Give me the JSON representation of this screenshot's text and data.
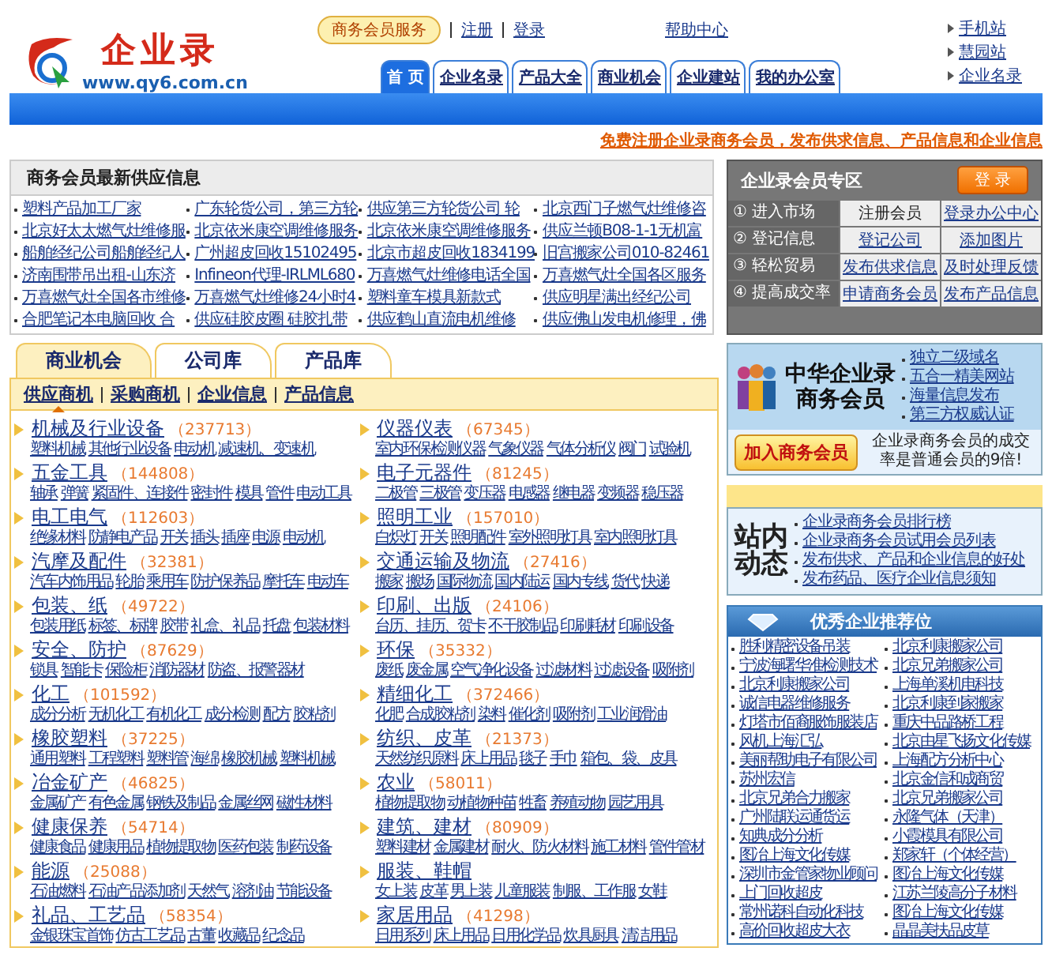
{
  "header": {
    "logo_text": "企业录",
    "logo_url": "www.qy6.com.cn",
    "service_badge": "商务会员服务",
    "links": [
      "注册",
      "登录"
    ],
    "help": "帮助中心",
    "nav": [
      {
        "label": "首 页",
        "selected": true
      },
      {
        "label": "企业名录",
        "selected": false
      },
      {
        "label": "产品大全",
        "selected": false
      },
      {
        "label": "商业机会",
        "selected": false
      },
      {
        "label": "企业建站",
        "selected": false
      },
      {
        "label": "我的办公室",
        "selected": false
      }
    ],
    "side_links": [
      "手机站",
      "慧园站",
      "企业名录"
    ]
  },
  "promo_link": "免费注册企业录商务会员，发布供求信息、产品信息和企业信息",
  "supply": {
    "title": "商务会员最新供应信息",
    "rows": [
      [
        "塑料产品加工厂家",
        "广东轮货公司，第三方轮",
        "供应第三方轮货公司 轮",
        "北京西门子燃气灶维修咨"
      ],
      [
        "北京好太太燃气灶维修服",
        "北京依米康空调维修服务",
        "北京依米康空调维修服务",
        "供应兰顿B08-1-1无机富"
      ],
      [
        "船舶经纪公司船舶经纪人",
        "广州超皮回收15102495",
        "北京市超皮回收1834199",
        "旧宫搬家公司010-82461"
      ],
      [
        "济南围带吊出租-山东济",
        "Infineon代理-IRLML680",
        "万喜燃气灶维修电话全国",
        "万喜燃气灶全国各区服务"
      ],
      [
        "万喜燃气灶全国各市维修",
        "万喜燃气灶维修24小时4",
        "塑料童车模具新款式",
        "供应明星满出经纪公司"
      ],
      [
        "合肥笔记本电脑回收 合",
        "供应硅胶皮圈 硅胶扎带",
        "供应鹤山直流电机维修",
        "供应佛山发电机修理，佛"
      ]
    ]
  },
  "member_zone": {
    "title": "企业录会员专区",
    "login_button": "登 录",
    "rows": [
      {
        "num": "①",
        "label": "进入市场",
        "links": [
          {
            "text": "注册会员",
            "link": false
          },
          {
            "text": "登录办公中心",
            "link": true
          }
        ]
      },
      {
        "num": "②",
        "label": "登记信息",
        "links": [
          {
            "text": "登记公司",
            "link": true
          },
          {
            "text": "添加图片",
            "link": true
          }
        ]
      },
      {
        "num": "③",
        "label": "轻松贸易",
        "links": [
          {
            "text": "发布供求信息",
            "link": true
          },
          {
            "text": "及时处理反馈",
            "link": true
          }
        ]
      },
      {
        "num": "④",
        "label": "提高成交率",
        "links": [
          {
            "text": "申请商务会员",
            "link": true
          },
          {
            "text": "发布产品信息",
            "link": true
          }
        ]
      }
    ]
  },
  "biz_tabs": [
    {
      "label": "商业机会",
      "selected": true
    },
    {
      "label": "公司库",
      "selected": false
    },
    {
      "label": "产品库",
      "selected": false
    }
  ],
  "sub_tabs": [
    {
      "label": "供应商机",
      "selected": true
    },
    {
      "label": "采购商机",
      "selected": false
    },
    {
      "label": "企业信息",
      "selected": false
    },
    {
      "label": "产品信息",
      "selected": false
    }
  ],
  "categories": [
    {
      "name": "机械及行业设备",
      "count": "（237713）",
      "subs": [
        "塑料机械",
        "其他行业设备",
        "电动机",
        "减速机、变速机"
      ]
    },
    {
      "name": "仪器仪表",
      "count": "（67345）",
      "subs": [
        "室内环保检测仪器",
        "气象仪器",
        "气体分析仪",
        "阀门",
        "试验机"
      ]
    },
    {
      "name": "五金工具",
      "count": "（144808）",
      "subs": [
        "轴承",
        "弹簧",
        "紧固件、连接件",
        "密封件",
        "模具",
        "管件",
        "电动工具"
      ]
    },
    {
      "name": "电子元器件",
      "count": "（81245）",
      "subs": [
        "二极管",
        "三极管",
        "变压器",
        "电感器",
        "继电器",
        "变频器",
        "稳压器"
      ]
    },
    {
      "name": "电工电气",
      "count": "（112603）",
      "subs": [
        "绝缘材料",
        "防静电产品",
        "开关",
        "插头",
        "插座",
        "电源",
        "电动机"
      ]
    },
    {
      "name": "照明工业",
      "count": "（157010）",
      "subs": [
        "白炽灯",
        "开关",
        "照明配件",
        "室外照明灯具",
        "室内照明灯具"
      ]
    },
    {
      "name": "汽摩及配件",
      "count": "（32381）",
      "subs": [
        "汽车内饰用品",
        "轮胎",
        "乘用车",
        "防护保养品",
        "摩托车",
        "电动车"
      ]
    },
    {
      "name": "交通运输及物流",
      "count": "（27416）",
      "subs": [
        "搬家",
        "搬场",
        "国际物流",
        "国内陆运",
        "国内专线",
        "货代",
        "快递"
      ]
    },
    {
      "name": "包装、纸",
      "count": "（49722）",
      "subs": [
        "包装用纸",
        "标签、标牌",
        "胶带",
        "礼盒、礼品",
        "托盘",
        "包装材料"
      ]
    },
    {
      "name": "印刷、出版",
      "count": "（24106）",
      "subs": [
        "台历、挂历、贺卡",
        "不干胶制品",
        "印刷耗材",
        "印刷设备"
      ]
    },
    {
      "name": "安全、防护",
      "count": "（87629）",
      "subs": [
        "锁具",
        "智能卡",
        "保险柜",
        "消防器材",
        "防盗、报警器材"
      ]
    },
    {
      "name": "环保",
      "count": "（35332）",
      "subs": [
        "废纸",
        "废金属",
        "空气净化设备",
        "过滤材料",
        "过滤设备",
        "吸附剂"
      ]
    },
    {
      "name": "化工",
      "count": "（101592）",
      "subs": [
        "成分分析",
        "无机化工",
        "有机化工",
        "成分检测",
        "配方",
        "胶粘剂"
      ]
    },
    {
      "name": "精细化工",
      "count": "（372466）",
      "subs": [
        "化肥",
        "合成胶粘剂",
        "染料",
        "催化剂",
        "吸附剂",
        "工业润滑油"
      ]
    },
    {
      "name": "橡胶塑料",
      "count": "（37225）",
      "subs": [
        "通用塑料",
        "工程塑料",
        "塑料管",
        "海绵",
        "橡胶机械",
        "塑料机械"
      ]
    },
    {
      "name": "纺织、皮革",
      "count": "（21373）",
      "subs": [
        "天然纺织原料",
        "床上用品",
        "毯子",
        "手巾",
        "箱包、袋、皮具"
      ]
    },
    {
      "name": "冶金矿产",
      "count": "（46825）",
      "subs": [
        "金属矿产",
        "有色金属",
        "钢铁及制品",
        "金属丝网",
        "磁性材料"
      ]
    },
    {
      "name": "农业",
      "count": "（58011）",
      "subs": [
        "植物提取物",
        "动植物种苗",
        "牲畜",
        "养殖动物",
        "园艺用具"
      ]
    },
    {
      "name": "健康保养",
      "count": "（54714）",
      "subs": [
        "健康食品",
        "健康用品",
        "植物提取物",
        "医药包装",
        "制药设备"
      ]
    },
    {
      "name": "建筑、建材",
      "count": "（80909）",
      "subs": [
        "塑料建材",
        "金属建材",
        "耐火、防火材料",
        "施工材料",
        "管件管材"
      ]
    },
    {
      "name": "能源",
      "count": "（25088）",
      "subs": [
        "石油燃料",
        "石油产品添加剂",
        "天然气",
        "溶剂油",
        "节能设备"
      ]
    },
    {
      "name": "服装、鞋帽",
      "subs": [
        "女上装",
        "皮革",
        "男上装",
        "儿童服装",
        "制服、工作服",
        "女鞋"
      ]
    },
    {
      "name": "礼品、工艺品",
      "count": "（58354）",
      "subs": [
        "金银珠宝首饰",
        "仿古工艺品",
        "古董",
        "收藏品",
        "纪念品"
      ]
    },
    {
      "name": "家居用品",
      "count": "（41298）",
      "subs": [
        "日用系列",
        "床上用品",
        "日用化学品",
        "炊具厨具",
        "清洁用品"
      ]
    }
  ],
  "vip_banner": {
    "title_lines": [
      "中华企业录",
      "商务会员"
    ],
    "features": [
      "独立二级域名",
      "五合一精美网站",
      "海量信息发布",
      "第三方权威认证"
    ],
    "join_button": "加入商务会员",
    "note": "企业录商务会员的成交率是普通会员的9倍!"
  },
  "news": {
    "title": "站内动态",
    "links": [
      "企业录商务会员排行榜",
      "企业录商务会员试用会员列表",
      "发布供求、产品和企业信息的好处",
      "发布药品、医疗企业信息须知"
    ]
  },
  "recommend": {
    "title": "优秀企业推荐位",
    "rows": [
      [
        "胜利精密设备吊装",
        "北京利康搬家公司"
      ],
      [
        "宁波海曙华准检测技术",
        "北京兄弟搬家公司"
      ],
      [
        "北京利康搬家公司",
        "上海单溪机电科技"
      ],
      [
        "诚信电器维修服务",
        "北京利康到家搬家"
      ],
      [
        "灯塔市佰裔服饰服装店",
        "重庆中品路桥工程"
      ],
      [
        "风机上海汇弘",
        "北京由星飞扬文化传媒"
      ],
      [
        "美丽帮助电子有限公司",
        "上海配方分析中心"
      ],
      [
        "苏州宏信",
        "北京金信和成商贸"
      ],
      [
        "北京兄弟合力搬家",
        "北京兄弟搬家公司"
      ],
      [
        "广州陆联运通货运",
        "永隆气体（天津）"
      ],
      [
        "知典成分分析",
        "小霞模具有限公司"
      ],
      [
        "图冶上海文化传媒",
        "郑家轩（个体经营）"
      ],
      [
        "深圳市金管家物业顾问",
        "图冶上海文化传媒"
      ],
      [
        "上门回收超皮",
        "江苏兰陵高分子材料"
      ],
      [
        "常州诺科自动化科技",
        "图冶上海文化传媒"
      ],
      [
        "高价回收超皮大衣",
        "晶晶美扶品皮草"
      ]
    ]
  }
}
